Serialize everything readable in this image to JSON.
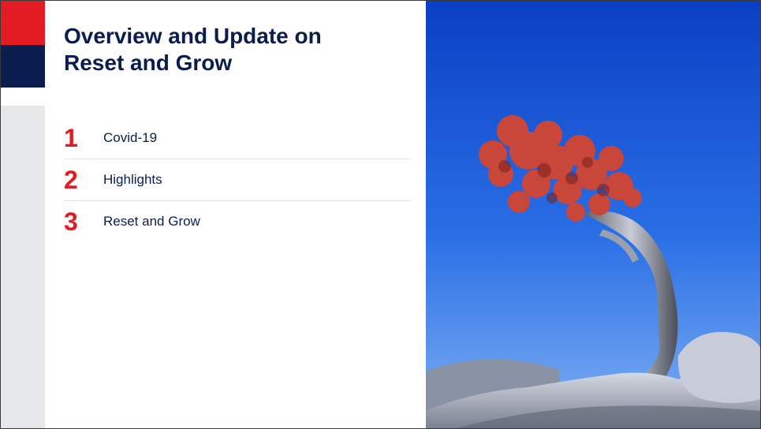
{
  "slide": {
    "title_line1": "Overview and Update on",
    "title_line2": "Reset and Grow",
    "agenda": [
      {
        "number": "1",
        "label": "Covid-19"
      },
      {
        "number": "2",
        "label": "Highlights"
      },
      {
        "number": "3",
        "label": "Reset and Grow"
      }
    ]
  },
  "colors": {
    "brand_red": "#e31b23",
    "brand_navy": "#0b1d4f",
    "side_grey": "#e6e7e8",
    "sky_blue": "#1f5ed8"
  },
  "image": {
    "subject": "red-leafed tree on rock against blue sky"
  }
}
